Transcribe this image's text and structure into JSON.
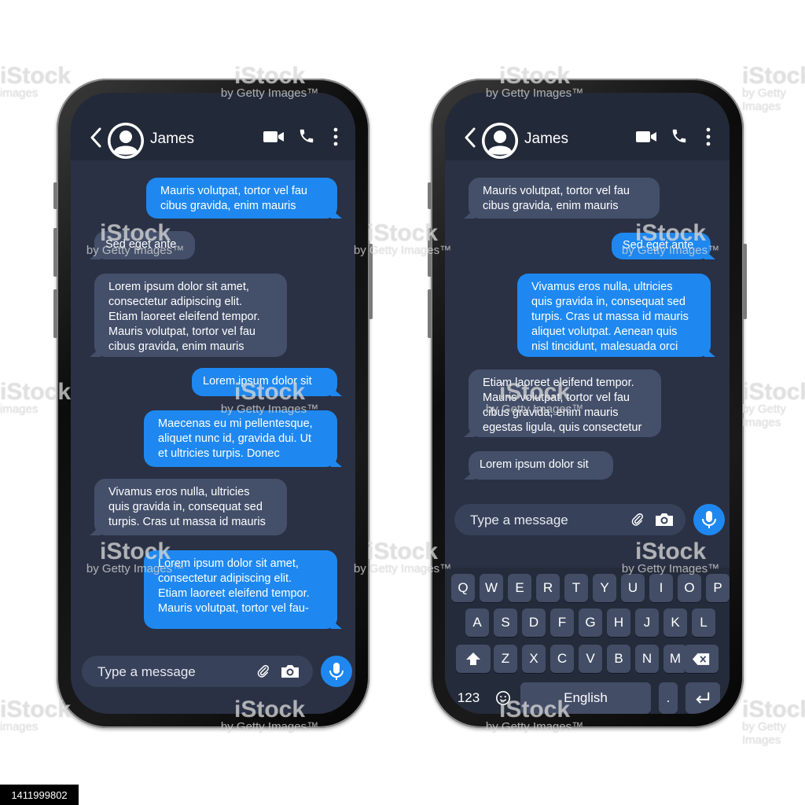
{
  "left_phone": {
    "contact_name": "James",
    "messages": [
      {
        "dir": "out",
        "text": "Mauris volutpat, tortor vel fau\ncibus gravida, enim mauris"
      },
      {
        "dir": "in",
        "text": "Sed eget ante"
      },
      {
        "dir": "in",
        "text": "Lorem ipsum dolor sit amet,\nconsectetur adipiscing elit.\nEtiam laoreet eleifend tempor.\nMauris volutpat, tortor vel fau\ncibus gravida, enim mauris"
      },
      {
        "dir": "out",
        "text": "Lorem ipsum dolor sit"
      },
      {
        "dir": "out",
        "text": "Maecenas eu mi pellentesque,\naliquet nunc id, gravida dui. Ut\net ultricies turpis. Donec"
      },
      {
        "dir": "in",
        "text": "Vivamus eros nulla, ultricies\nquis gravida in, consequat sed\nturpis. Cras ut massa id mauris"
      },
      {
        "dir": "out",
        "text": "Lorem ipsum dolor sit amet,\nconsectetur adipiscing elit.\nEtiam laoreet eleifend tempor.\nMauris volutpat, tortor vel fau-"
      }
    ],
    "input_placeholder": "Type a message"
  },
  "right_phone": {
    "contact_name": "James",
    "messages": [
      {
        "dir": "in",
        "text": "Mauris volutpat, tortor vel fau\ncibus gravida, enim mauris"
      },
      {
        "dir": "out",
        "text": "Sed eget ante"
      },
      {
        "dir": "out",
        "text": "Vivamus eros nulla, ultricies\nquis gravida in, consequat sed\nturpis. Cras ut massa id mauris\naliquet volutpat. Aenean quis\nnisl tincidunt, malesuada orci"
      },
      {
        "dir": "in",
        "text": "Etiam laoreet eleifend tempor.\nMauris volutpat, tortor vel fau\ncibus gravida, enim mauris\negestas ligula, quis consectetur"
      },
      {
        "dir": "in",
        "text": "Lorem ipsum dolor sit"
      }
    ],
    "input_placeholder": "Type a message",
    "keyboard": {
      "row1": [
        "Q",
        "W",
        "E",
        "R",
        "T",
        "Y",
        "U",
        "I",
        "O",
        "P"
      ],
      "row2": [
        "A",
        "S",
        "D",
        "F",
        "G",
        "H",
        "J",
        "K",
        "L"
      ],
      "row3": [
        "Z",
        "X",
        "C",
        "V",
        "B",
        "N",
        "M"
      ],
      "numbers_key": "123",
      "space_key": "English",
      "period_key": "."
    }
  },
  "icons": {
    "back": "chevron-left-icon",
    "avatar": "user-avatar-icon",
    "video": "video-camera-icon",
    "call": "phone-icon",
    "more": "more-vertical-icon",
    "attach": "paperclip-icon",
    "camera": "camera-icon",
    "mic": "microphone-icon",
    "shift": "shift-icon",
    "backspace": "backspace-icon",
    "emoji": "emoji-icon",
    "return": "return-icon"
  },
  "colors": {
    "screen_bg": "#2a3144",
    "header_bg": "#222938",
    "outgoing_bubble": "#1e88f0",
    "incoming_bubble": "#44506a",
    "accent": "#1e88f0"
  },
  "watermark": {
    "brand": "iStock",
    "credit": "by Getty Images",
    "credit_tm": "by Getty Images™",
    "images_word": "images",
    "stock_id": "1411999802"
  }
}
